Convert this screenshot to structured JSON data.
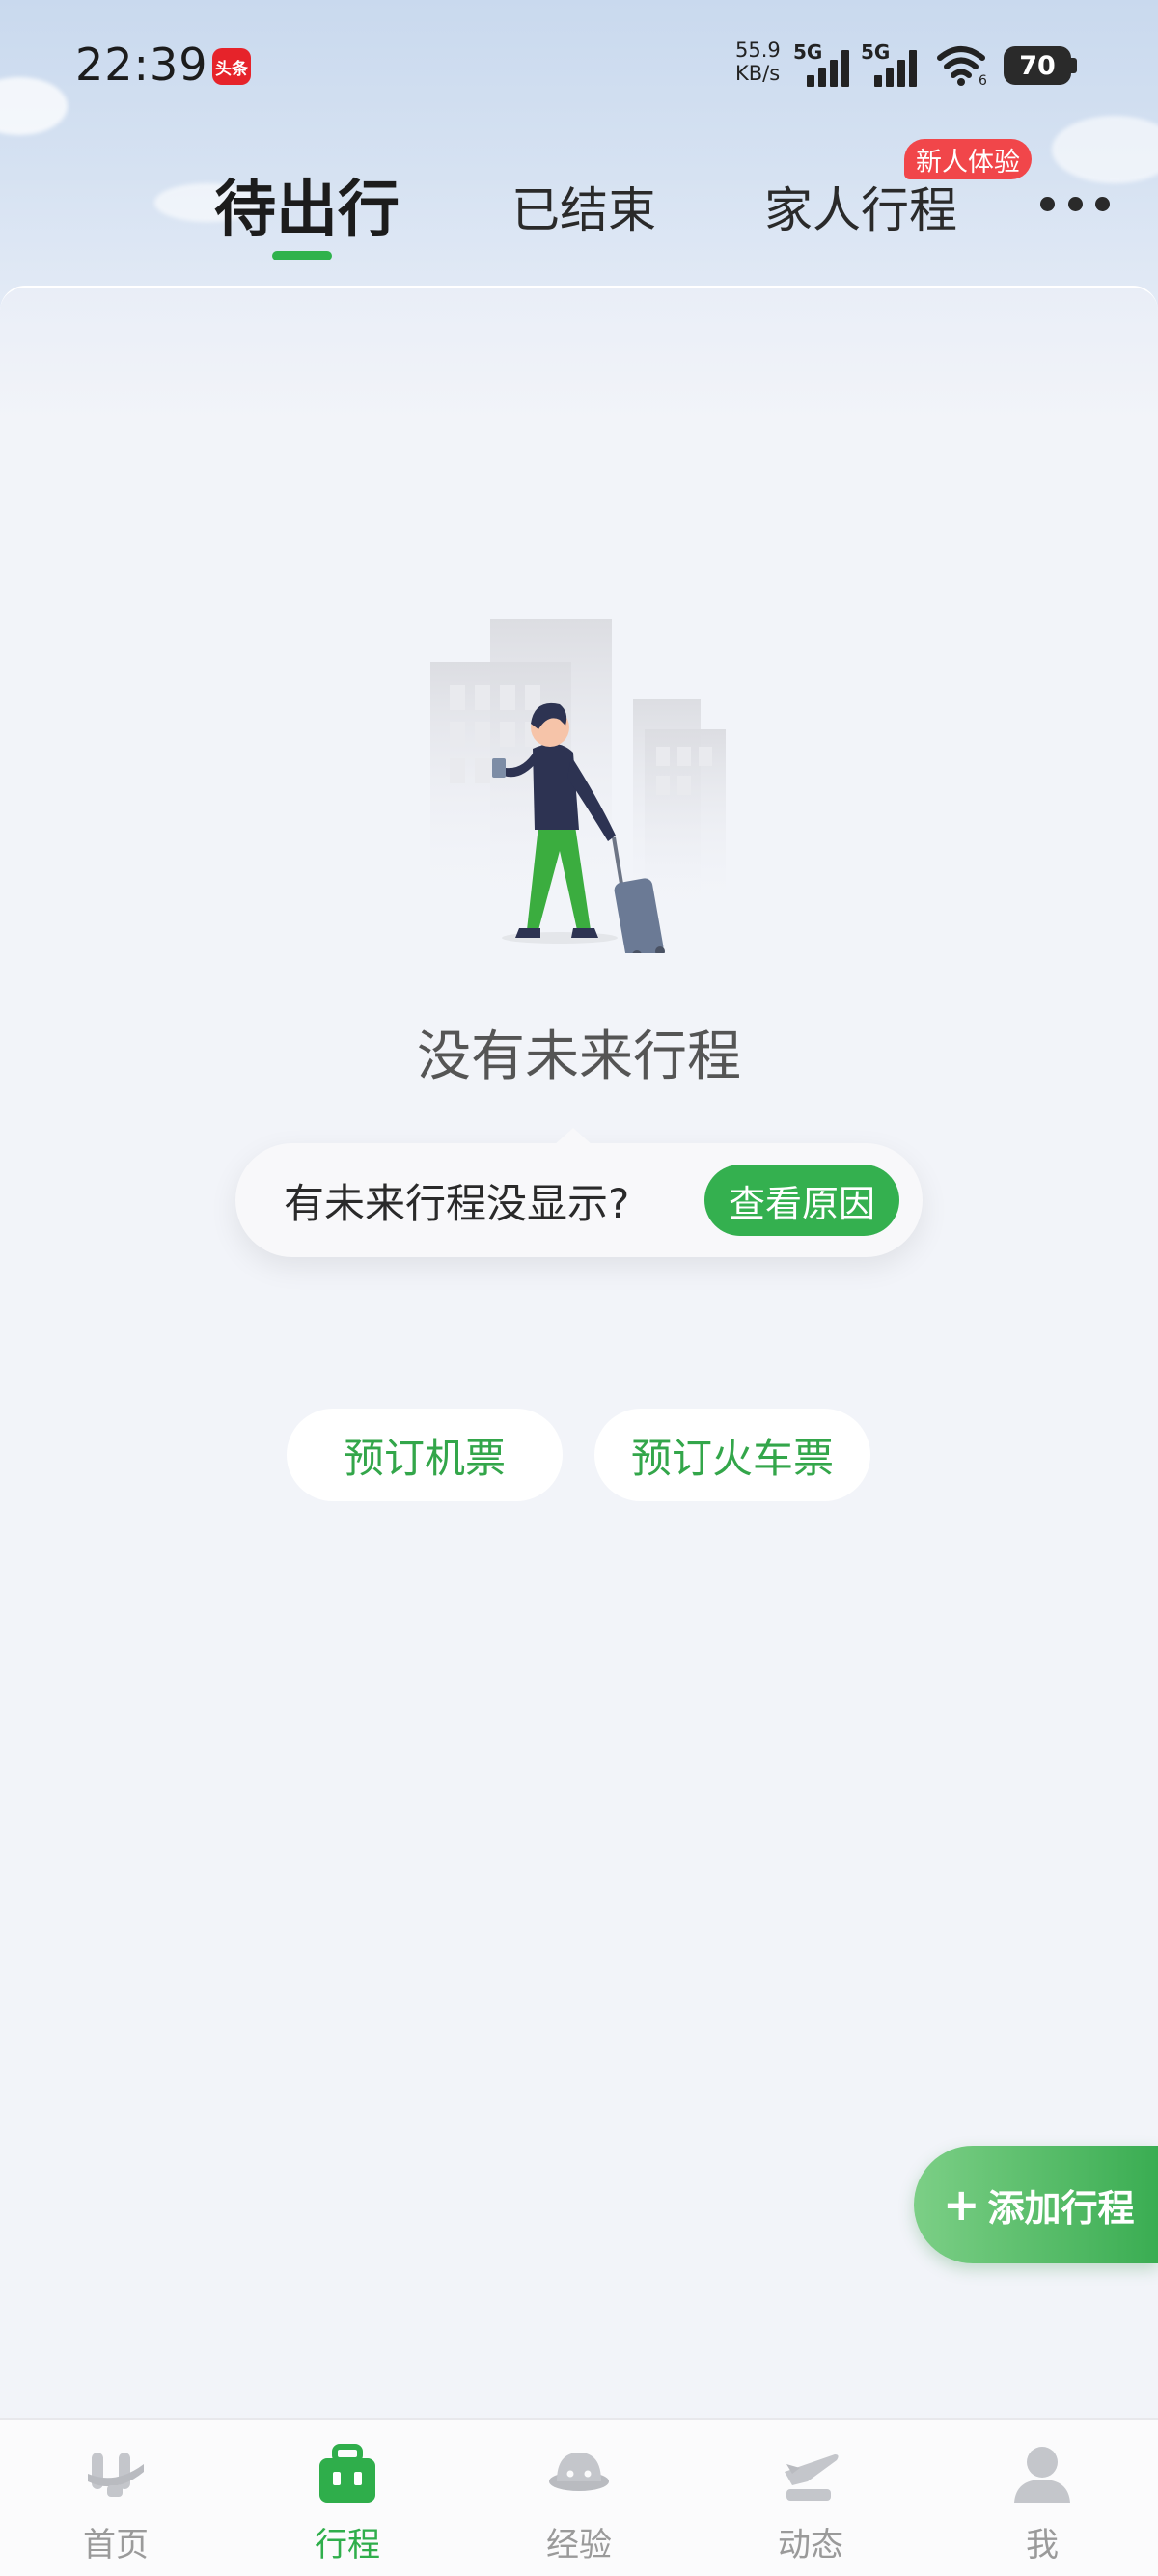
{
  "status_bar": {
    "time": "22:39",
    "app_badge": "头条",
    "net_speed_value": "55.9",
    "net_speed_unit": "KB/s",
    "signal1_label": "5G",
    "signal2_label": "5G",
    "wifi_label": "6",
    "battery": "70"
  },
  "tabs": [
    {
      "label": "待出行",
      "active": true
    },
    {
      "label": "已结束",
      "active": false
    },
    {
      "label": "家人行程",
      "active": false
    }
  ],
  "new_badge": "新人体验",
  "more_icon": "more-dots-icon",
  "empty_state": {
    "title": "没有未来行程",
    "hint_text": "有未来行程没显示?",
    "hint_button": "查看原因"
  },
  "actions": {
    "book_flight": "预订机票",
    "book_train": "预订火车票",
    "add_trip": "添加行程"
  },
  "bottom_nav": [
    {
      "label": "首页",
      "icon": "home-icon",
      "active": false
    },
    {
      "label": "行程",
      "icon": "trip-suitcase-icon",
      "active": true
    },
    {
      "label": "经验",
      "icon": "experience-icon",
      "active": false
    },
    {
      "label": "动态",
      "icon": "flight-status-icon",
      "active": false
    },
    {
      "label": "我",
      "icon": "profile-icon",
      "active": false
    }
  ],
  "colors": {
    "accent_green": "#34b04f",
    "badge_red": "#f1464a",
    "background": "#f2f4f9"
  }
}
